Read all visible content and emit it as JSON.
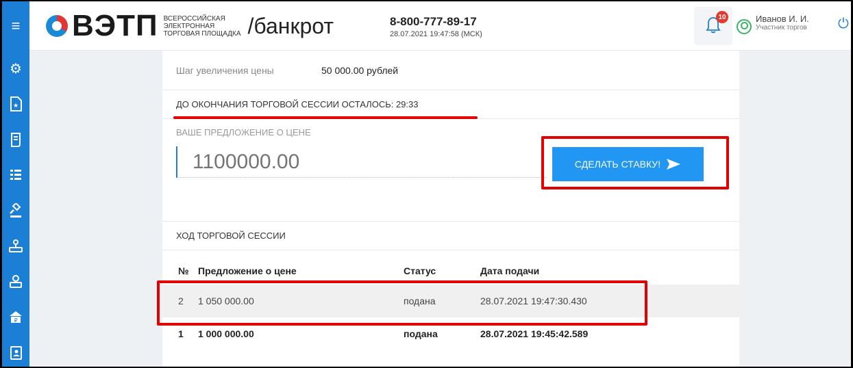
{
  "header": {
    "logo_word": "ВЭТП",
    "logo_sub": [
      "ВСЕРОССИЙСКАЯ",
      "ЭЛЕКТРОННАЯ",
      "ТОРГОВАЯ ПЛОЩАДКА"
    ],
    "section": "/банкрот",
    "phone": "8-800-777-89-17",
    "datetime": "28.07.2021 19:47:58 (МСК)",
    "notifications_count": "10",
    "user_name": "Иванов И. И.",
    "user_role": "Участник торгов"
  },
  "sidebar": {
    "icons": [
      "gear-icon",
      "document-star-icon",
      "scroll-icon",
      "list-icon",
      "gavel-icon",
      "stamp-icon",
      "seal-icon",
      "bank-icon",
      "contacts-icon"
    ]
  },
  "auction": {
    "step_label": "Шаг увеличения цены",
    "step_value": "50 000.00 рублей",
    "timer_text": "ДО ОКОНЧАНИЯ ТОРГОВОЙ СЕССИИ ОСТАЛОСЬ: 29:33",
    "bid_label": "ВАШЕ ПРЕДЛОЖЕНИЕ О ЦЕНЕ",
    "bid_placeholder": "1100000.00",
    "bid_button": "СДЕЛАТЬ СТАВКУ!",
    "session_title": "ХОД ТОРГОВОЙ СЕССИИ"
  },
  "table": {
    "headers": [
      "№",
      "Предложение о цене",
      "Статус",
      "Дата подачи"
    ],
    "rows": [
      {
        "num": "2",
        "price": "1 050 000.00",
        "status": "подана",
        "date": "28.07.2021 19:47:30.430"
      },
      {
        "num": "1",
        "price": "1 000 000.00",
        "status": "подана",
        "date": "28.07.2021 19:45:42.589"
      }
    ]
  },
  "colors": {
    "accent": "#1c7fd6",
    "button": "#2196f3",
    "highlight": "#e20000",
    "success": "#3bb36a"
  }
}
